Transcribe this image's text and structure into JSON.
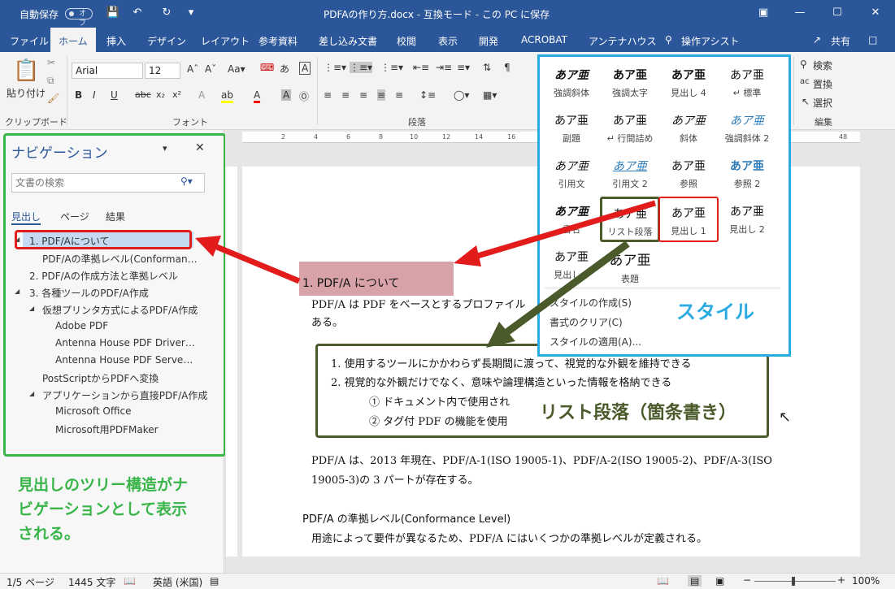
{
  "titlebar": {
    "autosave_label": "自動保存",
    "autosave_state": "オフ",
    "title": "PDFAの作り方.docx  -  互換モード - この PC に保存"
  },
  "tabs": [
    "ファイル",
    "ホーム",
    "挿入",
    "デザイン",
    "レイアウト",
    "参考資料",
    "差し込み文書",
    "校閲",
    "表示",
    "開発",
    "ACROBAT",
    "アンテナハウス"
  ],
  "tell_me": "操作アシスト",
  "share": "共有",
  "ribbon": {
    "paste_label": "貼り付け",
    "clipboard_group": "クリップボード",
    "font_group": "フォント",
    "paragraph_group": "段落",
    "edit_group": "編集",
    "font_name": "Arial",
    "font_size": "12",
    "find": "検索",
    "replace": "置換",
    "select": "選択"
  },
  "nav": {
    "title": "ナビゲーション",
    "search_placeholder": "文書の検索",
    "tabs": [
      "見出し",
      "ページ",
      "結果"
    ],
    "items": [
      "1. PDF/Aについて",
      "PDF/Aの準拠レベル(Conforman…",
      "2. PDF/Aの作成方法と準拠レベル",
      "3. 各種ツールのPDF/A作成",
      "仮想プリンタ方式によるPDF/A作成",
      "Adobe PDF",
      "Antenna House PDF Driver…",
      "Antenna House PDF Serve…",
      "PostScriptからPDFへ変換",
      "アプリケーションから直接PDF/A作成",
      "Microsoft Office",
      "Microsoft用PDFMaker"
    ]
  },
  "annotations": {
    "nav_note_1": "見出しのツリー構造がナ",
    "nav_note_2": "ビゲーションとして表示",
    "nav_note_3": "される。",
    "style_label": "スタイル",
    "list_label": "リスト段落（箇条書き）"
  },
  "doc": {
    "heading": "1.   PDF/A について",
    "p1": "PDF/A は PDF をベースとするプロファイル",
    "p1b": "ある。",
    "li1": "1.   使用するツールにかかわらず長期間に渡って、視覚的な外観を維持できる",
    "li2": "2.   視覚的な外観だけでなく、意味や論理構造といった情報を格納できる",
    "sub1": "①   ドキュメント内で使用され",
    "sub2": "②   タグ付 PDF の機能を使用",
    "p2": "PDF/A は、2013 年現在、PDF/A-1(ISO 19005-1)、PDF/A-2(ISO 19005-2)、PDF/A-3(ISO",
    "p2b": "19005-3)の 3 パートが存在する。",
    "h2": "PDF/A の準拠レベル(Conformance Level)",
    "p3": "用途によって要件が異なるため、PDF/A にはいくつかの準拠レベルが定義される。"
  },
  "gallery": {
    "styles": [
      {
        "preview": "あア亜",
        "name": "強調斜体"
      },
      {
        "preview": "あア亜",
        "name": "強調太字"
      },
      {
        "preview": "あア亜",
        "name": "見出し 4"
      },
      {
        "preview": "あア亜",
        "name": "↵ 標準"
      },
      {
        "preview": "あア亜",
        "name": "副題"
      },
      {
        "preview": "あア亜",
        "name": "↵ 行間詰め"
      },
      {
        "preview": "あア亜",
        "name": "斜体"
      },
      {
        "preview": "あア亜",
        "name": "強調斜体 2"
      },
      {
        "preview": "あア亜",
        "name": "引用文"
      },
      {
        "preview": "あア亜",
        "name": "引用文 2"
      },
      {
        "preview": "あア亜",
        "name": "参照"
      },
      {
        "preview": "あア亜",
        "name": "参照 2"
      },
      {
        "preview": "あア亜",
        "name": "書名"
      },
      {
        "preview": "あア亜",
        "name": "リスト段落"
      },
      {
        "preview": "あア亜",
        "name": "見出し 1"
      },
      {
        "preview": "あア亜",
        "name": "見出し 2"
      },
      {
        "preview": "あア亜",
        "name": "見出し 3"
      },
      {
        "preview": "あア亜",
        "name": "表題"
      }
    ],
    "menu": [
      "スタイルの作成(S)",
      "書式のクリア(C)",
      "スタイルの適用(A)..."
    ]
  },
  "status": {
    "page": "1/5 ページ",
    "words": "1445 文字",
    "lang": "英語 (米国)",
    "zoom": "100%"
  },
  "colors": {
    "word_blue": "#2b579a",
    "anno_green": "#39b54a",
    "anno_dark_green": "#4a5a2a",
    "anno_red": "#e21b1b",
    "gallery_border": "#29abe2"
  }
}
